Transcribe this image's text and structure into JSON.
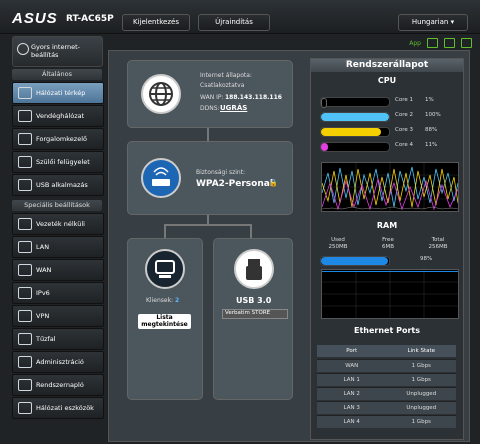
{
  "header": {
    "brand": "ASUS",
    "model": "RT-AC65P",
    "logout_label": "Kijelentkezés",
    "reboot_label": "Újraindítás",
    "language": "Hungarian",
    "app_label": "App"
  },
  "sidebar": {
    "quick_setup": "Gyors internet-beállítás",
    "general_title": "Általános",
    "general_items": [
      {
        "label": "Hálózati térkép",
        "icon": "network-map-icon"
      },
      {
        "label": "Vendéghálózat",
        "icon": "guest-network-icon"
      },
      {
        "label": "Forgalomkezelő",
        "icon": "traffic-manager-icon"
      },
      {
        "label": "Szülői felügyelet",
        "icon": "parental-control-icon"
      },
      {
        "label": "USB alkalmazás",
        "icon": "usb-app-icon"
      }
    ],
    "advanced_title": "Speciális beállítások",
    "advanced_items": [
      {
        "label": "Vezeték nélküli",
        "icon": "wireless-icon"
      },
      {
        "label": "LAN",
        "icon": "lan-icon"
      },
      {
        "label": "WAN",
        "icon": "wan-icon"
      },
      {
        "label": "IPv6",
        "icon": "ipv6-icon"
      },
      {
        "label": "VPN",
        "icon": "vpn-icon"
      },
      {
        "label": "Tűzfal",
        "icon": "firewall-icon"
      },
      {
        "label": "Adminisztráció",
        "icon": "admin-icon"
      },
      {
        "label": "Rendszernapló",
        "icon": "system-log-icon"
      },
      {
        "label": "Hálózati eszközök",
        "icon": "network-tools-icon"
      }
    ]
  },
  "network_map": {
    "internet_status_label": "Internet állapota:",
    "internet_status_value": "Csatlakoztatva",
    "wan_ip_label": "WAN IP:",
    "wan_ip": "188.143.118.116",
    "ddns_label": "DDNS:",
    "ddns_value": "UGRÁS",
    "security_label": "Biztonsági szint:",
    "security_value": "WPA2-Personal",
    "clients_label": "Kliensek:",
    "clients_count": "2",
    "client_list_button": "Lista megtekintése",
    "usb_label": "USB 3.0",
    "usb_device": "Verbatim STORE"
  },
  "system_status": {
    "title": "Rendszerállapot",
    "cpu_title": "CPU",
    "cores": [
      {
        "label": "Core 1",
        "value": "1%",
        "fraction": 0.01,
        "color": "#000000"
      },
      {
        "label": "Core 2",
        "value": "100%",
        "fraction": 1.0,
        "color": "#4fc3f7"
      },
      {
        "label": "Core 3",
        "value": "88%",
        "fraction": 0.88,
        "color": "#f5d000"
      },
      {
        "label": "Core 4",
        "value": "11%",
        "fraction": 0.11,
        "color": "#e040e0"
      }
    ],
    "ram_title": "RAM",
    "ram_used_label": "Used",
    "ram_used": "250MB",
    "ram_free_label": "Free",
    "ram_free": "6MB",
    "ram_total_label": "Total",
    "ram_total": "256MB",
    "ram_percent": "98%",
    "ram_fraction": 0.98,
    "eth_title": "Ethernet Ports",
    "eth_headers": [
      "Port",
      "Link State"
    ],
    "eth_rows": [
      [
        "WAN",
        "1 Gbps"
      ],
      [
        "LAN 1",
        "1 Gbps"
      ],
      [
        "LAN 2",
        "Unplugged"
      ],
      [
        "LAN 3",
        "Unplugged"
      ],
      [
        "LAN 4",
        "1 Gbps"
      ]
    ]
  }
}
